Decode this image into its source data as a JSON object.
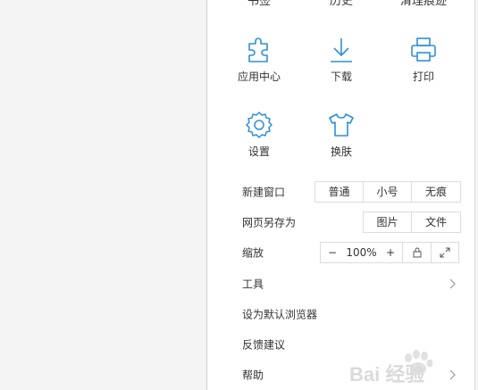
{
  "top_row": {
    "left": "书签",
    "middle": "历史",
    "right": "清理痕迹"
  },
  "icons": [
    {
      "label": "应用中心",
      "icon": "puzzle-icon"
    },
    {
      "label": "下载",
      "icon": "download-icon"
    },
    {
      "label": "打印",
      "icon": "printer-icon"
    },
    {
      "label": "设置",
      "icon": "gear-icon"
    },
    {
      "label": "换肤",
      "icon": "tshirt-icon"
    }
  ],
  "rows": {
    "new_window": {
      "label": "新建窗口",
      "options": [
        "普通",
        "小号",
        "无痕"
      ]
    },
    "save_page": {
      "label": "网页另存为",
      "options": [
        "图片",
        "文件"
      ]
    },
    "zoom": {
      "label": "缩放",
      "minus": "−",
      "value": "100%",
      "plus": "+"
    },
    "tools": {
      "label": "工具"
    },
    "default_browser": {
      "label": "设为默认浏览器"
    },
    "feedback": {
      "label": "反馈建议"
    },
    "help": {
      "label": "帮助"
    }
  },
  "watermark": {
    "text": "Bai 经验"
  },
  "colors": {
    "icon_blue": "#2f8fd8",
    "border": "#dcdcdc",
    "text": "#333333"
  }
}
